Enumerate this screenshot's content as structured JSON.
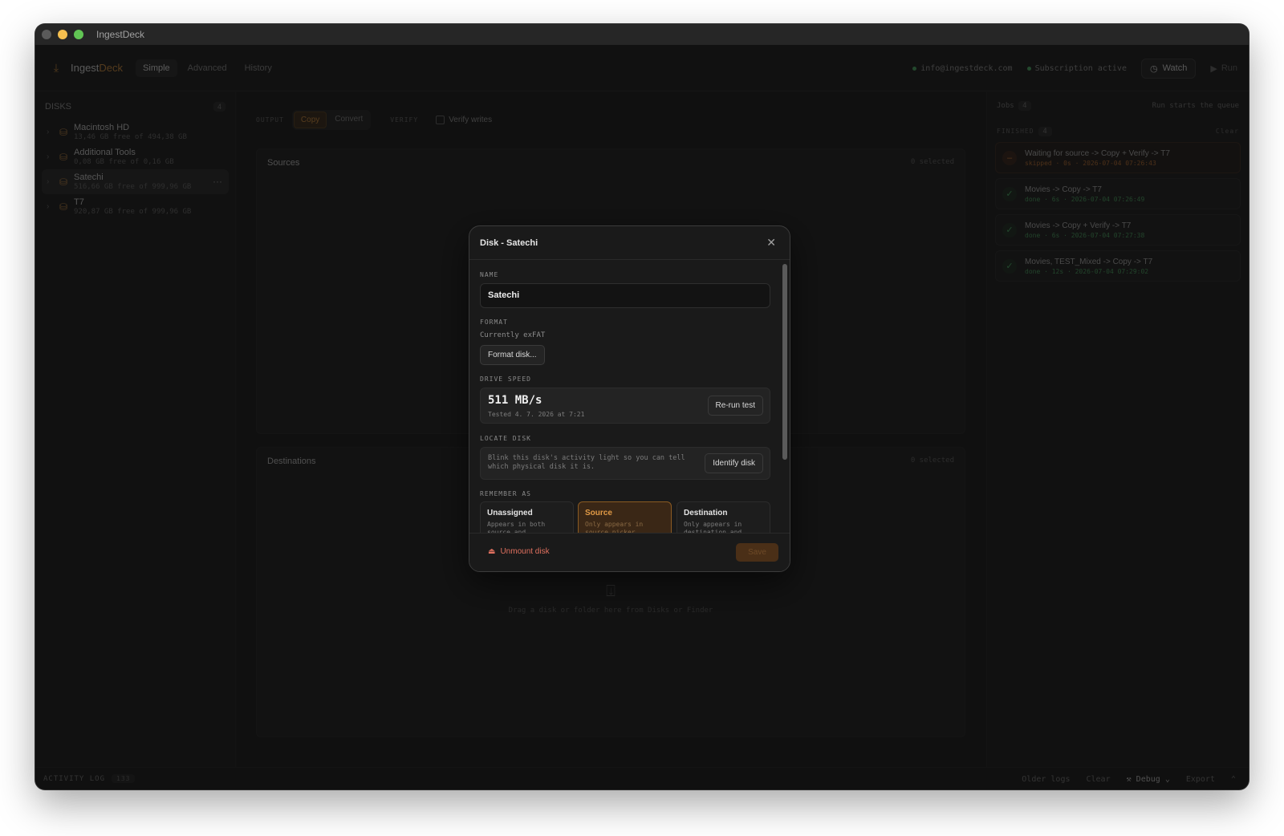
{
  "window": {
    "title": "IngestDeck"
  },
  "topbar": {
    "brand_main": "Ingest",
    "brand_accent": "Deck",
    "tabs": [
      {
        "label": "Simple",
        "active": true
      },
      {
        "label": "Advanced",
        "active": false
      },
      {
        "label": "History",
        "active": false
      }
    ],
    "account": "info@ingestdeck.com",
    "subscription": "Subscription active",
    "watch_label": "Watch",
    "run_label": "Run"
  },
  "sidebar": {
    "title": "DISKS",
    "count": "4",
    "disks": [
      {
        "name": "Macintosh HD",
        "sub": "13,46 GB free of 494,38 GB",
        "selected": false
      },
      {
        "name": "Additional Tools",
        "sub": "0,08 GB free of 0,16 GB",
        "selected": false
      },
      {
        "name": "Satechi",
        "sub": "516,66 GB free of 999,96 GB",
        "selected": true
      },
      {
        "name": "T7",
        "sub": "920,87 GB free of 999,96 GB",
        "selected": false
      }
    ]
  },
  "main": {
    "output_label": "OUTPUT",
    "output_options": [
      {
        "label": "Copy",
        "active": true
      },
      {
        "label": "Convert",
        "active": false
      }
    ],
    "verify_label": "VERIFY",
    "verify_writes": "Verify writes",
    "sources": {
      "title": "Sources",
      "count": "0 selected"
    },
    "destinations": {
      "title": "Destinations",
      "count": "0 selected",
      "hint": "Drag a disk or folder here from Disks or Finder"
    }
  },
  "jobs": {
    "title": "Jobs",
    "count": "4",
    "hint": "Run starts the queue",
    "finished_label": "FINISHED",
    "finished_count": "4",
    "clear_label": "Clear",
    "items": [
      {
        "title": "Waiting for source -> Copy + Verify -> T7",
        "meta": "skipped · 0s · 2026-07-04 07:26:43",
        "status": "skipped"
      },
      {
        "title": "Movies -> Copy -> T7",
        "meta": "done · 6s · 2026-07-04 07:26:49",
        "status": "done"
      },
      {
        "title": "Movies -> Copy + Verify -> T7",
        "meta": "done · 6s · 2026-07-04 07:27:38",
        "status": "done"
      },
      {
        "title": "Movies, TEST_Mixed -> Copy -> T7",
        "meta": "done · 12s · 2026-07-04 07:29:02",
        "status": "done"
      }
    ]
  },
  "statusbar": {
    "activity_label": "ACTIVITY LOG",
    "activity_count": "133",
    "older_logs": "Older logs",
    "clear": "Clear",
    "debug": "Debug",
    "export": "Export"
  },
  "modal": {
    "title": "Disk - Satechi",
    "name_label": "NAME",
    "name_value": "Satechi",
    "format_label": "FORMAT",
    "format_current": "Currently exFAT",
    "format_button": "Format disk...",
    "speed_label": "DRIVE SPEED",
    "speed_value": "511 MB/s",
    "speed_tested": "Tested 4. 7. 2026 at 7:21",
    "rerun_button": "Re-run test",
    "locate_label": "LOCATE DISK",
    "locate_text": "Blink this disk's activity light so you can tell which physical disk it is.",
    "identify_button": "Identify disk",
    "remember_label": "REMEMBER AS",
    "roles": [
      {
        "title": "Unassigned",
        "desc": "Appears in both source and",
        "active": false
      },
      {
        "title": "Source",
        "desc": "Only appears in source picker",
        "active": true
      },
      {
        "title": "Destination",
        "desc": "Only appears in destination and",
        "active": false
      }
    ],
    "unmount_label": "Unmount disk",
    "save_label": "Save"
  },
  "colors": {
    "accent": "#d8903d",
    "success": "#4db56a",
    "danger": "#e0705f",
    "background": "#1b1b1b"
  },
  "icons": {
    "logo": "download-icon",
    "disk": "drive-icon",
    "close": "close-icon",
    "watch": "clock-icon",
    "run": "play-icon",
    "done": "check-icon",
    "skipped": "minus-icon",
    "unmount": "eject-drive-icon",
    "drop": "inbox-icon"
  }
}
